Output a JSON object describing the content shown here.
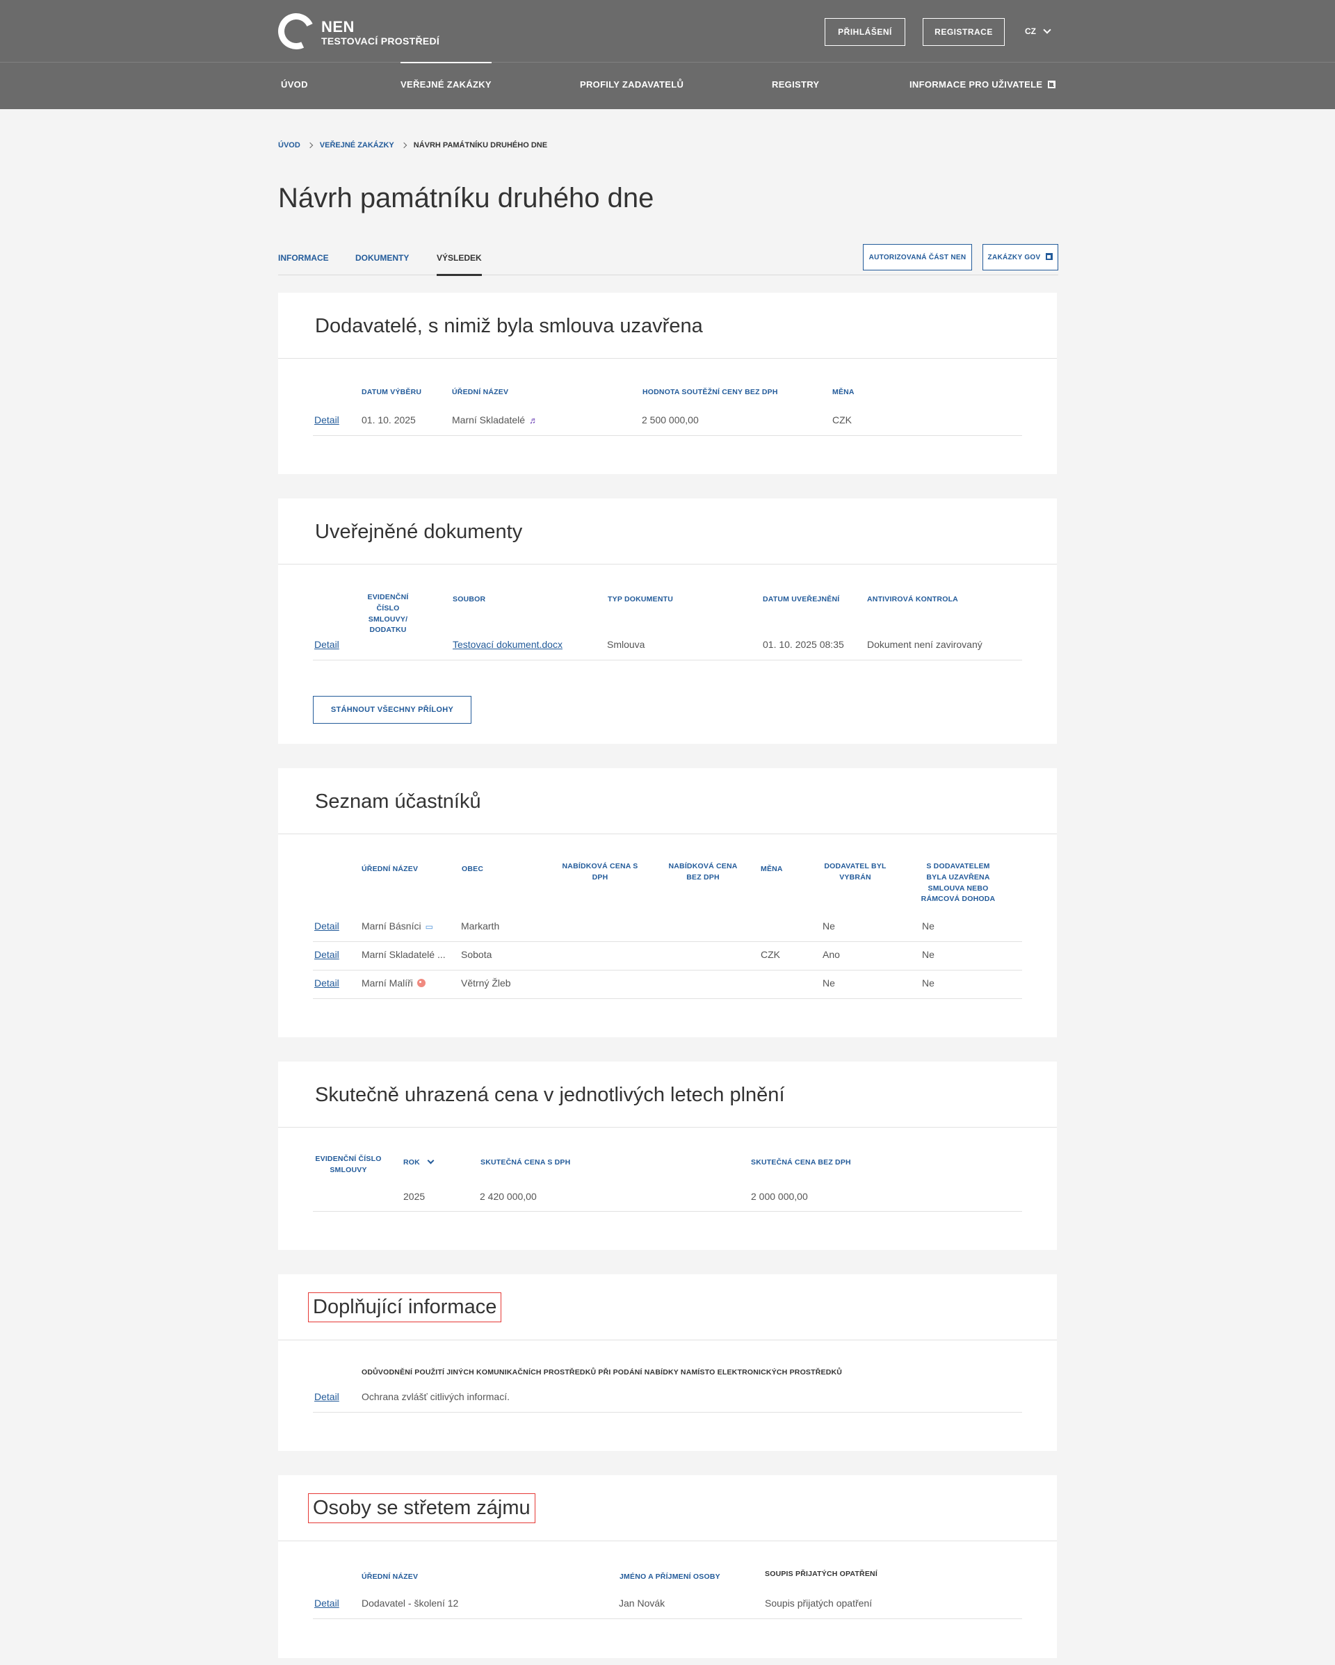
{
  "header": {
    "logo_title": "NEN",
    "logo_subtitle": "TESTOVACÍ PROSTŘEDÍ",
    "login_label": "PŘIHLÁŠENÍ",
    "register_label": "REGISTRACE",
    "language": "CZ"
  },
  "nav": {
    "items": [
      "ÚVOD",
      "VEŘEJNÉ ZAKÁZKY",
      "PROFILY ZADAVATELŮ",
      "REGISTRY",
      "INFORMACE PRO UŽIVATELE"
    ],
    "active_index": 1
  },
  "breadcrumb": [
    "ÚVOD",
    "VEŘEJNÉ ZAKÁZKY",
    "NÁVRH PAMÁTNÍKU DRUHÉHO DNE"
  ],
  "page_title": "Návrh památníku druhého dne",
  "tabs": [
    "INFORMACE",
    "DOKUMENTY",
    "VÝSLEDEK"
  ],
  "active_tab": "VÝSLEDEK",
  "tab_buttons": [
    "AUTORIZOVANÁ ČÁST NEN",
    "ZAKÁZKY GOV"
  ],
  "detail_label": "Detail",
  "suppliers": {
    "title": "Dodavatelé, s nimiž byla smlouva uzavřena",
    "headers": [
      "DATUM VÝBĚRU",
      "ÚŘEDNÍ NÁZEV",
      "HODNOTA SOUTĚŽNÍ CENY BEZ DPH",
      "MĚNA"
    ],
    "rows": [
      {
        "date": "01. 10. 2025",
        "name": "Marní Skladatelé",
        "icon": "music-note-icon",
        "value": "2 500 000,00",
        "currency": "CZK"
      }
    ]
  },
  "documents": {
    "title": "Uveřejněné dokumenty",
    "headers": [
      "EVIDENČNÍ ČÍSLO SMLOUVY/ DODATKU",
      "SOUBOR",
      "TYP DOKUMENTU",
      "DATUM UVEŘEJNĚNÍ",
      "ANTIVIROVÁ KONTROLA"
    ],
    "rows": [
      {
        "number": "",
        "file": "Testovací dokument.docx",
        "type": "Smlouva",
        "published": "01. 10. 2025 08:35",
        "antivirus": "Dokument není zavirovaný"
      }
    ],
    "download_all_label": "STÁHNOUT VŠECHNY PŘÍLOHY"
  },
  "participants": {
    "title": "Seznam účastníků",
    "headers": [
      "ÚŘEDNÍ NÁZEV",
      "OBEC",
      "NABÍDKOVÁ CENA S DPH",
      "NABÍDKOVÁ CENA BEZ DPH",
      "MĚNA",
      "DODAVATEL BYL VYBRÁN",
      "S DODAVATELEM BYLA UZAVŘENA SMLOUVA NEBO RÁMCOVÁ DOHODA"
    ],
    "rows": [
      {
        "name": "Marní Básníci",
        "icon": "book-icon",
        "city": "Markarth",
        "price_vat": "",
        "price_novat": "",
        "currency": "",
        "selected": "Ne",
        "contract": "Ne"
      },
      {
        "name": "Marní Skladatelé ...",
        "icon": "",
        "city": "Sobota",
        "price_vat": "",
        "price_novat": "",
        "currency": "CZK",
        "selected": "Ano",
        "contract": "Ne"
      },
      {
        "name": "Marní Malíři",
        "icon": "palette-icon",
        "city": "Větrný Žleb",
        "price_vat": "",
        "price_novat": "",
        "currency": "",
        "selected": "Ne",
        "contract": "Ne"
      }
    ]
  },
  "paid": {
    "title": "Skutečně uhrazená cena v jednotlivých letech plnění",
    "headers": [
      "EVIDENČNÍ ČÍSLO SMLOUVY",
      "ROK",
      "SKUTEČNÁ CENA S DPH",
      "SKUTEČNÁ CENA BEZ DPH"
    ],
    "rows": [
      {
        "number": "",
        "year": "2025",
        "vat": "2 420 000,00",
        "novat": "2 000 000,00"
      }
    ]
  },
  "additional": {
    "title": "Doplňující informace",
    "headers": [
      "ODŮVODNĚNÍ POUŽITÍ JINÝCH KOMUNIKAČNÍCH PROSTŘEDKŮ PŘI PODÁNÍ NABÍDKY NAMÍSTO ELEKTRONICKÝCH PROSTŘEDKŮ"
    ],
    "rows": [
      {
        "reason": "Ochrana zvlášť citlivých informací."
      }
    ]
  },
  "conflict": {
    "title": "Osoby se střetem zájmu",
    "headers": [
      "ÚŘEDNÍ NÁZEV",
      "JMÉNO A PŘÍJMENÍ OSOBY",
      "SOUPIS PŘIJATÝCH OPATŘENÍ"
    ],
    "rows": [
      {
        "name": "Dodavatel - školení 12",
        "person": "Jan Novák",
        "measures": "Soupis přijatých opatření"
      }
    ]
  },
  "colors": {
    "header_bg": "#6b6b6b",
    "link": "#235b9a",
    "highlight_box": "#e53935"
  }
}
